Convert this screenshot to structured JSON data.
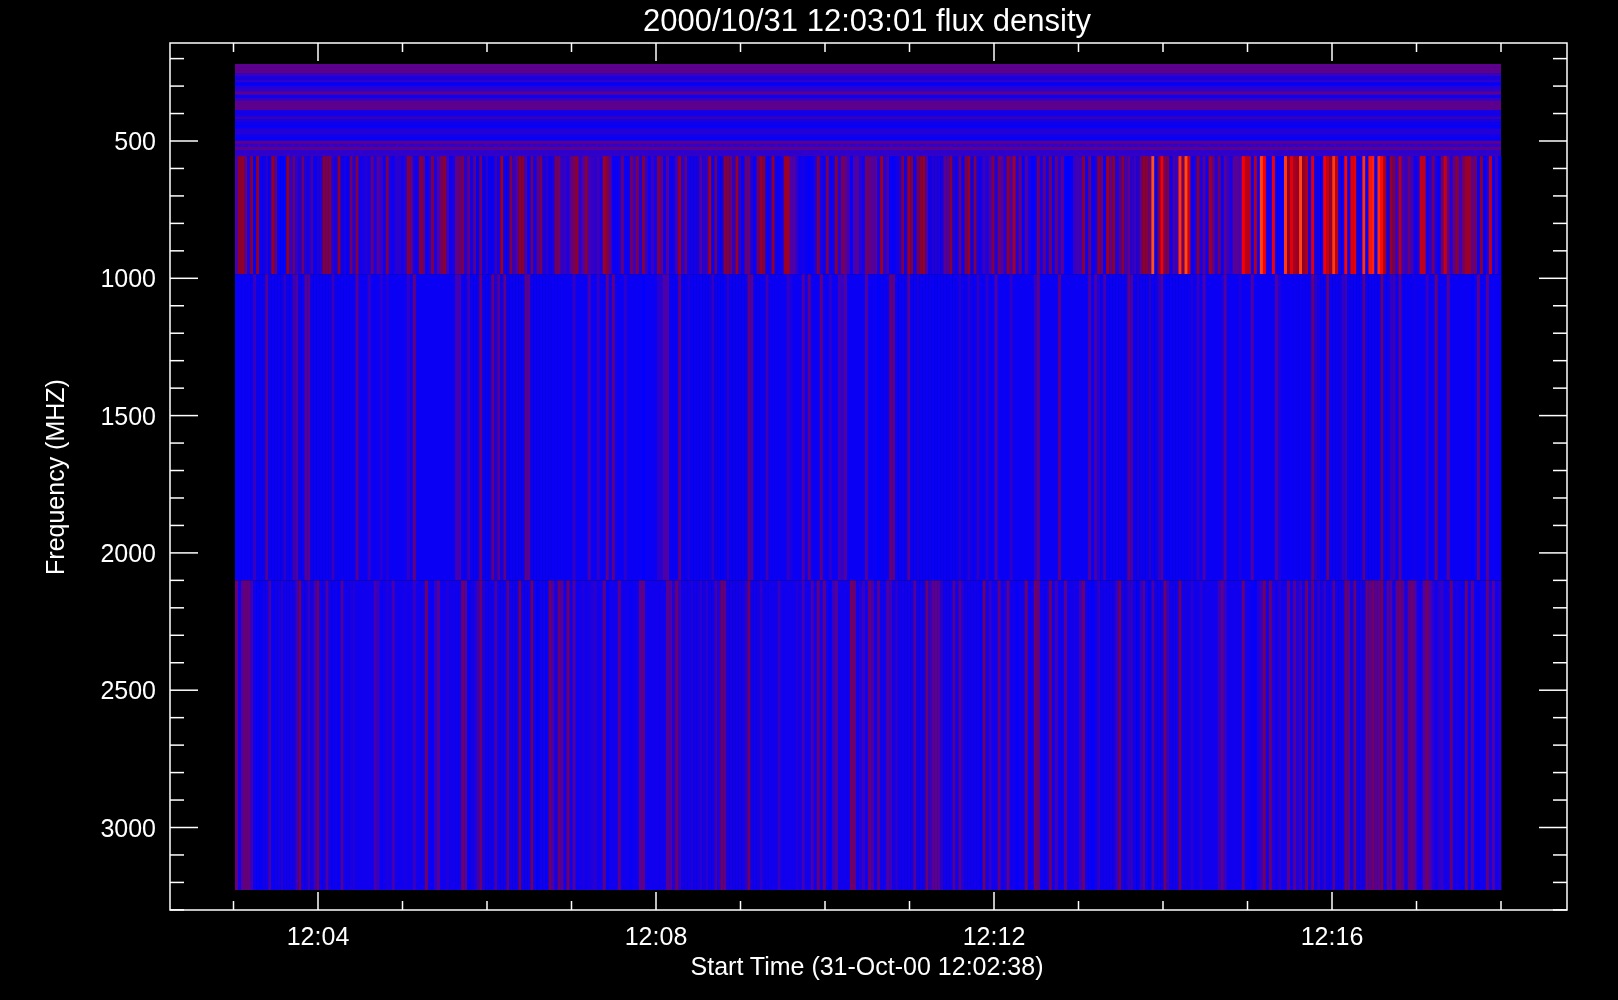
{
  "plot": {
    "title": "2000/10/31 12:03:01 flux density",
    "x_axis": {
      "label": "Start Time (31-Oct-00 12:02:38)",
      "ticks": [
        "12:04",
        "12:08",
        "12:12",
        "12:16"
      ]
    },
    "y_axis": {
      "label": "Frequency (MHZ)",
      "ticks": [
        "500",
        "1000",
        "1500",
        "2000",
        "2500",
        "3000"
      ]
    }
  }
}
